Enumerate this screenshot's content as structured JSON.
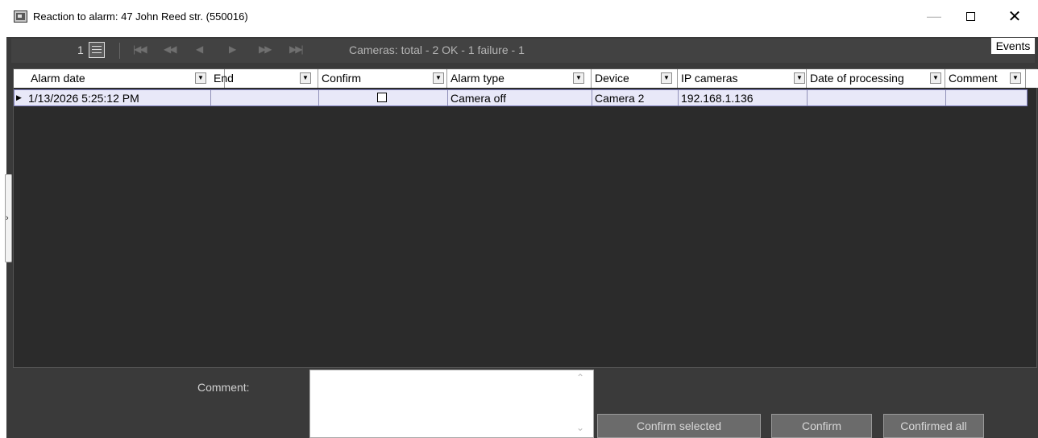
{
  "window": {
    "title": "Reaction to alarm: 47 John Reed str. (550016)",
    "minimize_glyph": "—",
    "close_glyph": "✕"
  },
  "toolbar": {
    "page_number": "1",
    "cameras_status": "Cameras: total - 2  OK - 1  failure - 1",
    "events_label": "Events",
    "nav_icons": [
      "first-page-icon",
      "prev-page-icon",
      "prev-record-icon",
      "next-record-icon",
      "next-page-icon",
      "last-page-icon"
    ]
  },
  "grid": {
    "columns": [
      "Alarm date",
      "End",
      "Confirm",
      "Alarm type",
      "Device",
      "IP cameras",
      "Date of processing",
      "Comment"
    ],
    "rows": [
      {
        "alarm_date": "1/13/2026 5:25:12 PM",
        "end": "",
        "confirm": false,
        "alarm_type": "Camera off",
        "device": "Camera 2",
        "ip_cameras": "192.168.1.136",
        "date_of_processing": "",
        "comment": ""
      }
    ]
  },
  "bottom": {
    "comment_label": "Comment:",
    "comment_value": "",
    "confirm_selected_label": "Confirm selected",
    "confirm_label": "Confirm",
    "confirmed_all_label": "Confirmed all"
  },
  "colors": {
    "background": "#3a3a3a",
    "grid_background": "#2b2b2b",
    "selected_row": "#e8e8f8",
    "button": "#6b6b6b"
  }
}
